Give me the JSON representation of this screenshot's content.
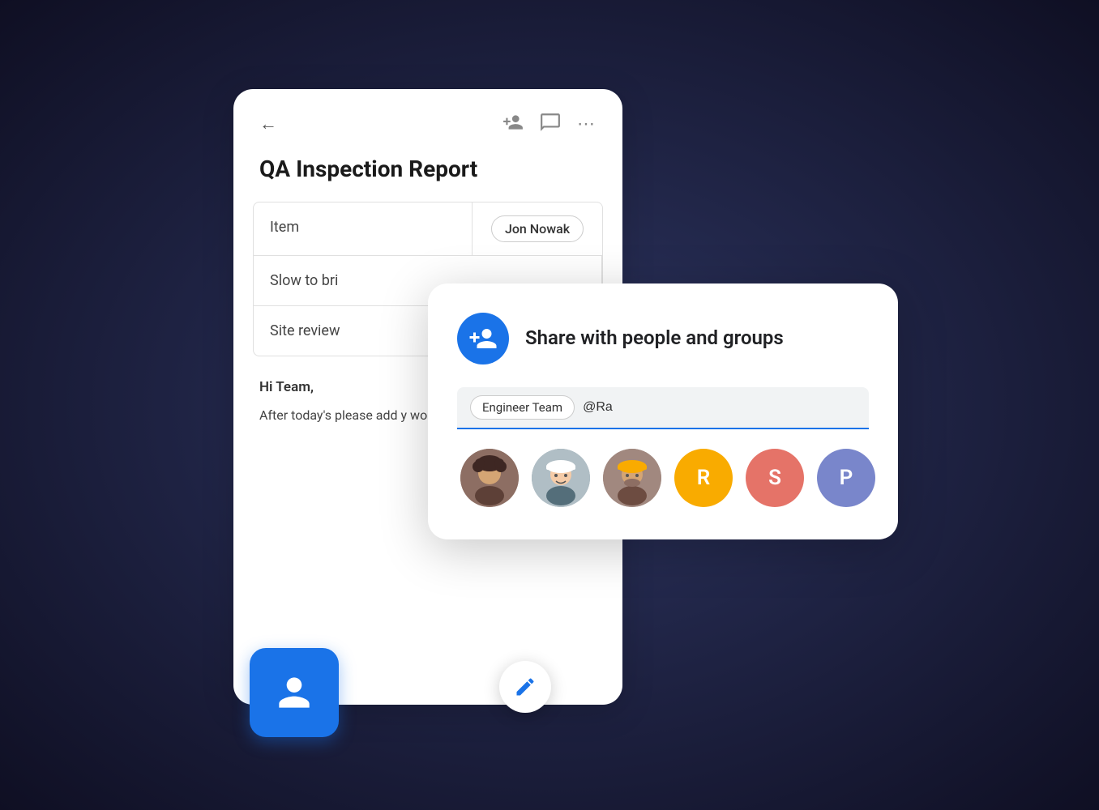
{
  "doc": {
    "title": "QA Inspection Report",
    "table": {
      "rows": [
        {
          "left": "Item",
          "right": "Jon Nowak"
        },
        {
          "left": "Slow to bri",
          "right": ""
        },
        {
          "left": "Site review",
          "right": ""
        }
      ]
    },
    "body": {
      "greeting": "Hi Team,",
      "text": "After today's please add y working doc before next week."
    }
  },
  "share": {
    "title": "Share with people and groups",
    "tag": "Engineer Team",
    "input_value": "@Ra",
    "input_placeholder": "@Ra"
  },
  "avatars": [
    {
      "type": "photo",
      "id": "person1",
      "label": "Person 1"
    },
    {
      "type": "photo",
      "id": "person2",
      "label": "Person 2"
    },
    {
      "type": "photo",
      "id": "person3",
      "label": "Person 3"
    },
    {
      "type": "letter",
      "letter": "R",
      "class": "avatar-r",
      "label": "R"
    },
    {
      "type": "letter",
      "letter": "S",
      "class": "avatar-s",
      "label": "S"
    },
    {
      "type": "letter",
      "letter": "P",
      "class": "avatar-p",
      "label": "P"
    }
  ],
  "icons": {
    "back": "←",
    "add_person": "person-add-icon",
    "notes": "notes-icon",
    "more": "more-icon",
    "edit": "edit-icon",
    "user": "user-icon"
  }
}
